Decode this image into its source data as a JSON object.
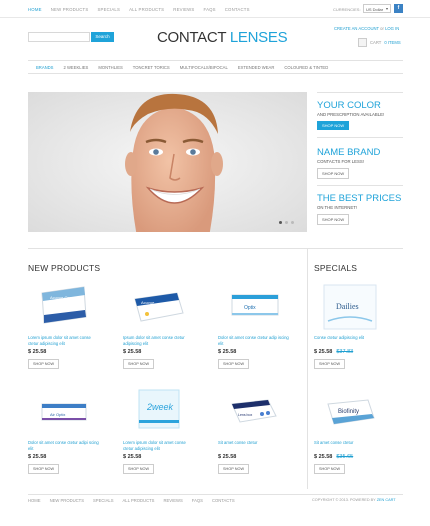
{
  "topbar": {
    "nav": [
      "HOME",
      "NEW PRODUCTS",
      "SPECIALS",
      "ALL PRODUCTS",
      "REVIEWS",
      "FAQS",
      "CONTACTS"
    ],
    "currency_label": "CURRENCIES:",
    "currency_value": "US Dollar",
    "social_icon": "facebook-icon"
  },
  "header": {
    "search_button": "Search",
    "search_value": "",
    "logo_main": "CONTACT ",
    "logo_accent": "LENSES",
    "create_account": "CREATE AN ACCOUNT",
    "login": "LOG IN",
    "cart_label": "CART",
    "cart_count": "0 ITEMS"
  },
  "mainnav": [
    "BRANDS",
    "2 WEEKLIES",
    "MONTHLIES",
    "TONCRET TORICS",
    "MULTIFOCALS/BIFOCAL",
    "EXTENDED WEAR",
    "COLOURED & TINTED"
  ],
  "promos": [
    {
      "title": "YOUR COLOR",
      "sub": "AND PRESCRIPTION AVAILABLE!",
      "button": "SHOP NOW"
    },
    {
      "title": "NAME BRAND",
      "sub": "CONTACTS FOR LESS!",
      "button": "SHOP NOW"
    },
    {
      "title": "THE BEST PRICES",
      "sub": "ON THE INTERNET!",
      "button": "SHOP NOW"
    }
  ],
  "new_products": {
    "title": "NEW PRODUCTS",
    "items": [
      {
        "name": "Lorem ipsum dolor sit amet conse ctetur adipiscing elit",
        "price": "$ 25.58",
        "button": "SHOP NOW",
        "brand": "Acuvue Oasys"
      },
      {
        "name": "Ipsum dolor sit amet conse ctetur adipiscing elit",
        "price": "$ 25.58",
        "button": "SHOP NOW",
        "brand": "Acuvue"
      },
      {
        "name": "Dolor sit amet conse ctetur adip iscing elit",
        "price": "$ 25.58",
        "button": "SHOP NOW",
        "brand": "Optix"
      },
      {
        "name": "Dolor sit amet conse ctetur adipi scing elit",
        "price": "$ 25.58",
        "button": "SHOP NOW",
        "brand": "Air Optix"
      },
      {
        "name": "Lorem ipsum dolor sit amet conse ctetur adipiscing elit",
        "price": "$ 25.58",
        "button": "SHOP NOW",
        "brand": "2week"
      },
      {
        "name": "Sit amet conse ctetur",
        "price": "$ 25.58",
        "button": "SHOP NOW",
        "brand": "Lens box"
      }
    ]
  },
  "specials": {
    "title": "SPECIALS",
    "items": [
      {
        "name": "Conse ctetur adipiscing elit",
        "price": "$ 25.58",
        "old_price": "$37.83",
        "button": "SHOP NOW",
        "brand": "Dailies"
      },
      {
        "name": "Sit amet conse ctetur",
        "price": "$ 25.58",
        "old_price": "$35.65",
        "button": "SHOP NOW",
        "brand": "Biofinity"
      }
    ]
  },
  "footer": {
    "nav": [
      "HOME",
      "NEW PRODUCTS",
      "SPECIALS",
      "ALL PRODUCTS",
      "REVIEWS",
      "FAQS",
      "CONTACTS"
    ],
    "copyright": "COPYRIGHT © 2013. POWERED BY ",
    "powered_by": "ZEN CART"
  }
}
